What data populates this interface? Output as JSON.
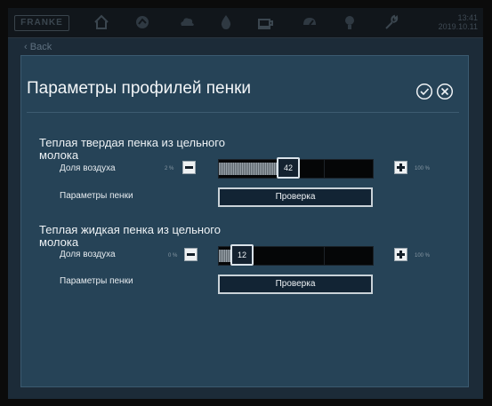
{
  "topbar": {
    "brand": "FRANKE",
    "clock_time": "13:41",
    "clock_date": "2019.10.11",
    "icons": [
      "home-icon",
      "stat-icon",
      "cloud-icon",
      "drop-icon",
      "cup-icon",
      "gauge-icon",
      "bulb-icon",
      "wrench-icon"
    ]
  },
  "nav": {
    "back_label": "Back"
  },
  "dialog": {
    "title": "Параметры профилей пенки",
    "confirm_icon": "check-circle-icon",
    "close_icon": "close-circle-icon"
  },
  "profiles": [
    {
      "title_line1": "Теплая твердая пенка из цельного",
      "title_line2": "молока",
      "air_label": "Доля воздуха",
      "min_label": "2 %",
      "max_label": "100 %",
      "value": "42",
      "value_fraction": 0.42,
      "settings_label": "Параметры пенки",
      "check_button": "Проверка"
    },
    {
      "title_line1": "Теплая жидкая пенка из цельного",
      "title_line2": "молока",
      "air_label": "Доля воздуха",
      "min_label": "0 %",
      "max_label": "100 %",
      "value": "12",
      "value_fraction": 0.12,
      "settings_label": "Параметры пенки",
      "check_button": "Проверка"
    }
  ],
  "colors": {
    "panel": "#264357",
    "screen": "#1c2b38",
    "topbar": "#11161b"
  }
}
